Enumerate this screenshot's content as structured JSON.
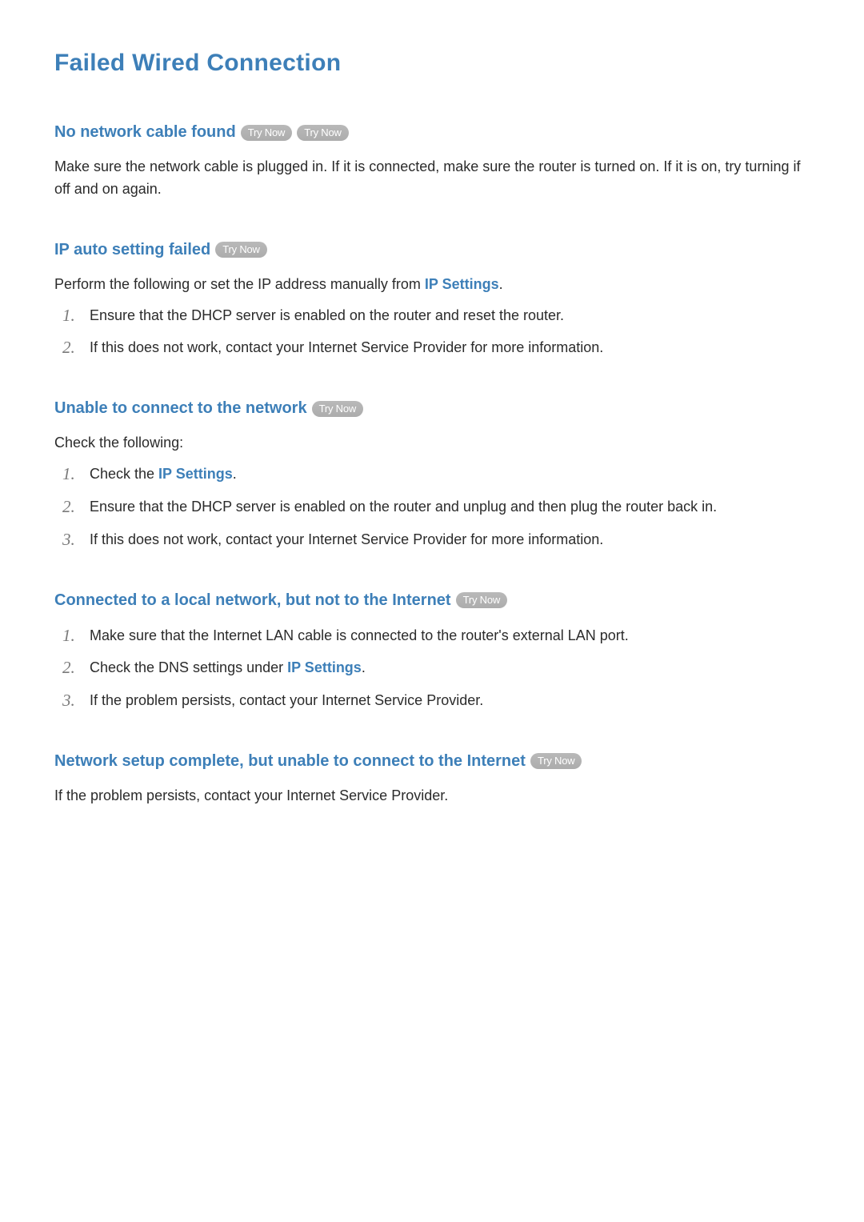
{
  "page_title": "Failed Wired Connection",
  "try_now_label": "Try Now",
  "sections": {
    "s1": {
      "heading": "No network cable found",
      "body": "Make sure the network cable is plugged in. If it is connected, make sure the router is turned on. If it is on, try turning if off and on again."
    },
    "s2": {
      "heading": "IP auto setting failed",
      "intro_before": "Perform the following or set the IP address manually from ",
      "intro_link": "IP Settings",
      "intro_after": ".",
      "items": {
        "i1": "Ensure that the DHCP server is enabled on the router and reset the router.",
        "i2": "If this does not work, contact your Internet Service Provider for more information."
      }
    },
    "s3": {
      "heading": "Unable to connect to the network",
      "intro": "Check the following:",
      "items": {
        "i1_before": "Check the ",
        "i1_link": "IP Settings",
        "i1_after": ".",
        "i2": "Ensure that the DHCP server is enabled on the router and unplug and then plug the router back in.",
        "i3": "If this does not work, contact your Internet Service Provider for more information."
      }
    },
    "s4": {
      "heading": "Connected to a local network, but not to the Internet",
      "items": {
        "i1": "Make sure that the Internet LAN cable is connected to the router's external LAN port.",
        "i2_before": "Check the DNS settings under ",
        "i2_link": "IP Settings",
        "i2_after": ".",
        "i3": "If the problem persists, contact your Internet Service Provider."
      }
    },
    "s5": {
      "heading": "Network setup complete, but unable to connect to the Internet",
      "body": "If the problem persists, contact your Internet Service Provider."
    }
  }
}
